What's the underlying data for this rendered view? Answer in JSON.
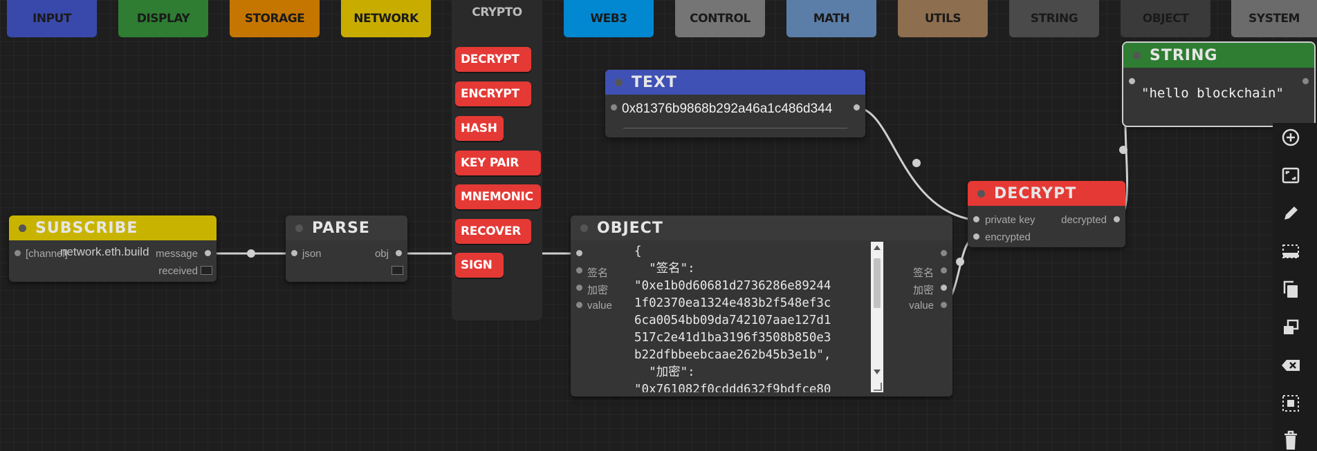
{
  "categories": [
    {
      "label": "INPUT",
      "color": "#3949ab",
      "text": "#1a1a1a"
    },
    {
      "label": "DISPLAY",
      "color": "#2e7d32",
      "text": "#1a1a1a"
    },
    {
      "label": "STORAGE",
      "color": "#c57600",
      "text": "#1a1a1a"
    },
    {
      "label": "NETWORK",
      "color": "#c8ad00",
      "text": "#1a1a1a"
    },
    {
      "label": "CRYPTO",
      "color": "transparent",
      "text": "#bbbbbb"
    },
    {
      "label": "WEB3",
      "color": "#0288d1",
      "text": "#1a1a1a"
    },
    {
      "label": "CONTROL",
      "color": "#757575",
      "text": "#1a1a1a"
    },
    {
      "label": "MATH",
      "color": "#5b7ea8",
      "text": "#1a1a1a"
    },
    {
      "label": "UTILS",
      "color": "#8d6e4e",
      "text": "#1a1a1a"
    },
    {
      "label": "STRING",
      "color": "#4a4a4a",
      "text": "#1a1a1a"
    },
    {
      "label": "OBJECT",
      "color": "#3a3a3a",
      "text": "#1a1a1a"
    },
    {
      "label": "SYSTEM",
      "color": "#6b6b6b",
      "text": "#1a1a1a"
    }
  ],
  "crypto_menu": [
    "DECRYPT",
    "ENCRYPT",
    "HASH",
    "KEY PAIR",
    "MNEMONIC",
    "RECOVER",
    "SIGN"
  ],
  "nodes": {
    "subscribe": {
      "title": "SUBSCRIBE",
      "color": "#c8b400",
      "input_label": "[channel]",
      "input_value": "network.eth.build",
      "out_message": "message",
      "out_received": "received"
    },
    "parse": {
      "title": "PARSE",
      "color": "#3a3a3a",
      "in_json": "json",
      "out_obj": "obj"
    },
    "text": {
      "title": "TEXT",
      "color": "#3f51b5",
      "value": "0x81376b9868b292a46a1c486d344"
    },
    "object": {
      "title": "OBJECT",
      "color": "#3a3a3a",
      "inputs": [
        "签名",
        "加密",
        "value"
      ],
      "outputs": [
        "签名",
        "加密",
        "value"
      ],
      "json_text": "{\n  \"签名\":\n\"0xe1b0d60681d2736286e89244\n1f02370ea1324e483b2f548ef3c\n6ca0054bb09da742107aae127d1\n517c2e41d1ba3196f3508b850e3\nb22dfbbeebcaae262b45b3e1b\",\n  \"加密\":\n\"0x761082f0cddd632f9bdfce80"
    },
    "decrypt": {
      "title": "DECRYPT",
      "color": "#e53935",
      "in_private_key": "private key",
      "in_encrypted": "encrypted",
      "out_decrypted": "decrypted"
    },
    "string": {
      "title": "STRING",
      "color": "#2e7d32",
      "value": "\"hello blockchain\""
    }
  },
  "toolbar": [
    "zoom-in-icon",
    "fit-view-icon",
    "edit-icon",
    "select-area-icon",
    "copy-icon",
    "duplicate-icon",
    "delete-back-icon",
    "group-icon",
    "trash-icon"
  ]
}
